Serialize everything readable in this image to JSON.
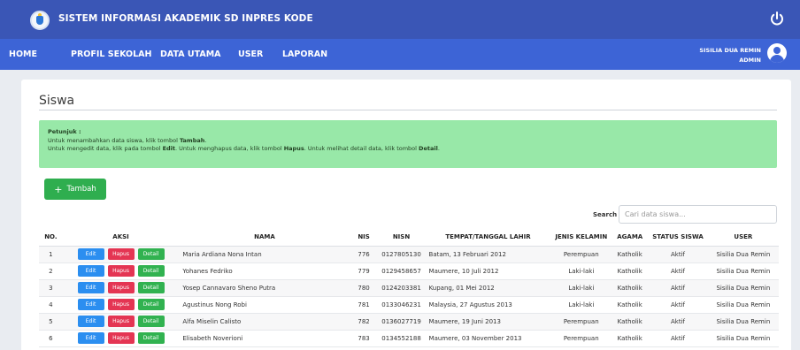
{
  "app": {
    "title": "SISTEM INFORMASI AKADEMIK SD INPRES KODE"
  },
  "nav": {
    "items": [
      "HOME",
      "PROFIL SEKOLAH",
      "DATA UTAMA",
      "USER",
      "LAPORAN"
    ]
  },
  "user": {
    "name": "SISILIA DUA REMIN",
    "role": "ADMIN"
  },
  "page": {
    "title": "Siswa"
  },
  "info": {
    "heading": "Petunjuk :",
    "line1_pre": "Untuk menambahkan data siswa, klik tombol ",
    "line1_btn": "Tambah",
    "line1_post": ".",
    "line2_pre": "Untuk mengedit data, klik pada tombol ",
    "line2_edit": "Edit",
    "line2_mid": ". Untuk menghapus data, klik tombol ",
    "line2_hapus": "Hapus",
    "line2_mid2": ". Untuk melihat detail data, klik tombol ",
    "line2_detail": "Detail",
    "line2_post": "."
  },
  "actions": {
    "add_label": "Tambah",
    "edit": "Edit",
    "hapus": "Hapus",
    "detail": "Detail"
  },
  "search": {
    "label": "Search",
    "placeholder": "Cari data siswa..."
  },
  "table": {
    "headers": [
      "NO.",
      "AKSI",
      "NAMA",
      "NIS",
      "NISN",
      "TEMPAT/TANGGAL LAHIR",
      "JENIS KELAMIN",
      "AGAMA",
      "STATUS SISWA",
      "USER"
    ],
    "rows": [
      [
        "1",
        "Maria Ardiana Nona Intan",
        "776",
        "0127805130",
        "Batam, 13 Februari 2012",
        "Perempuan",
        "Katholik",
        "Aktif",
        "Sisilia Dua Remin"
      ],
      [
        "2",
        "Yohanes Fedriko",
        "779",
        "0129458657",
        "Maumere, 10 Juli 2012",
        "Laki-laki",
        "Katholik",
        "Aktif",
        "Sisilia Dua Remin"
      ],
      [
        "3",
        "Yosep Cannavaro Sheno Putra",
        "780",
        "0124203381",
        "Kupang, 01 Mei 2012",
        "Laki-laki",
        "Katholik",
        "Aktif",
        "Sisilia Dua Remin"
      ],
      [
        "4",
        "Agustinus Nong Robi",
        "781",
        "0133046231",
        "Malaysia, 27 Agustus 2013",
        "Laki-laki",
        "Katholik",
        "Aktif",
        "Sisilia Dua Remin"
      ],
      [
        "5",
        "Alfa Miselin Calisto",
        "782",
        "0136027719",
        "Maumere, 19 Juni 2013",
        "Perempuan",
        "Katholik",
        "Aktif",
        "Sisilia Dua Remin"
      ],
      [
        "6",
        "Elisabeth Noverioni",
        "783",
        "0134552188",
        "Maumere, 03 November 2013",
        "Perempuan",
        "Katholik",
        "Aktif",
        "Sisilia Dua Remin"
      ]
    ]
  },
  "colors": {
    "topbar": "#3a56b6",
    "navbar": "#3d64d6",
    "info_bg": "#98e8a8",
    "edit": "#2b8ef0",
    "hapus": "#e43553",
    "detail": "#31b250"
  }
}
